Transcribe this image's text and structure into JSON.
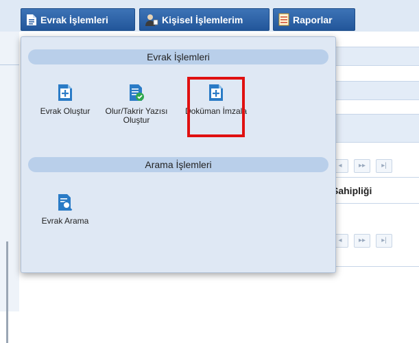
{
  "topbar": {
    "buttons": [
      {
        "label": "Evrak İşlemleri",
        "icon": "document-icon"
      },
      {
        "label": "Kişisel İşlemlerim",
        "icon": "user-icon"
      },
      {
        "label": "Raporlar",
        "icon": "report-icon"
      }
    ]
  },
  "background": {
    "column_header": "Sahipliği",
    "pager": [
      "◂",
      "▸▸",
      "▸|"
    ]
  },
  "dropdown": {
    "sections": [
      {
        "title": "Evrak İşlemleri",
        "items": [
          {
            "label": "Evrak Oluştur",
            "icon": "document-plus-icon"
          },
          {
            "label": "Olur/Takrir Yazısı Oluştur",
            "icon": "document-approve-icon"
          },
          {
            "label": "Doküman İmzala",
            "icon": "document-sign-icon",
            "highlighted": true
          }
        ]
      },
      {
        "title": "Arama İşlemleri",
        "items": [
          {
            "label": "Evrak Arama",
            "icon": "document-search-icon"
          }
        ]
      }
    ]
  },
  "colors": {
    "accent": "#2a5fa5",
    "highlight": "#e01010",
    "panel": "#dfe8f4",
    "section": "#b9cfea"
  }
}
